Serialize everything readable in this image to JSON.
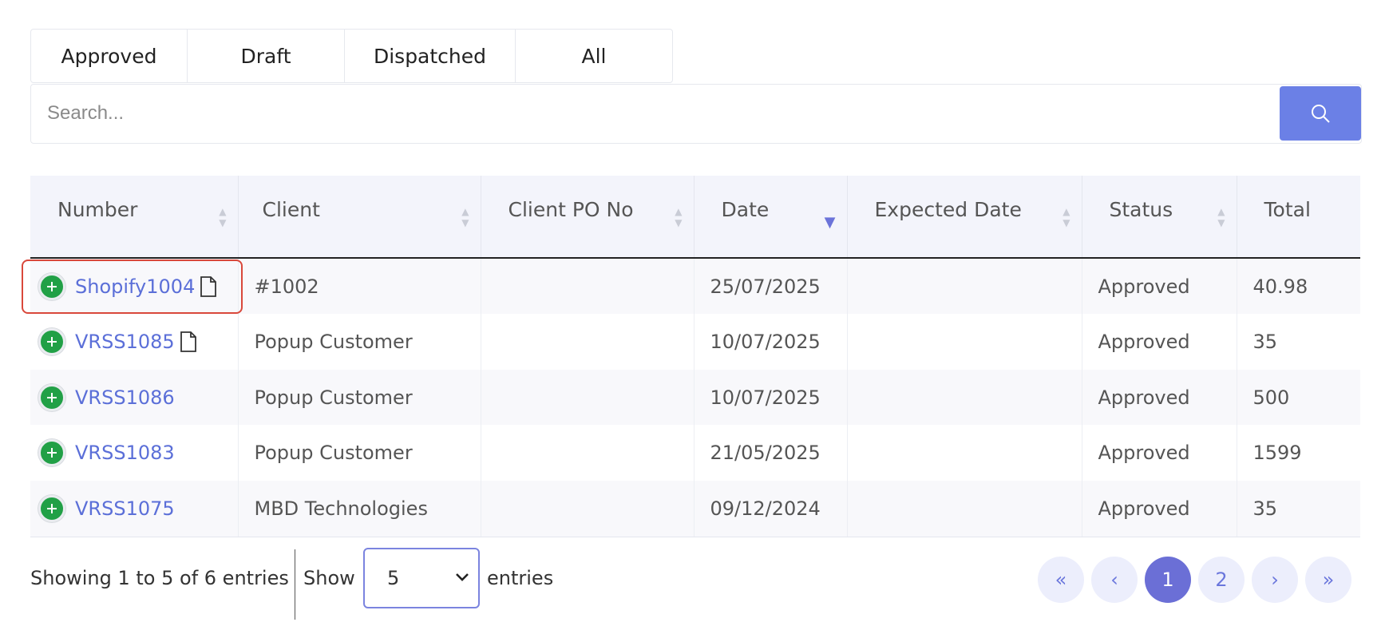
{
  "tabs": [
    "Approved",
    "Draft",
    "Dispatched",
    "All"
  ],
  "search": {
    "placeholder": "Search..."
  },
  "table": {
    "headers": [
      "Number",
      "Client",
      "Client PO No",
      "Date",
      "Expected Date",
      "Status",
      "Total"
    ],
    "rows": [
      {
        "number": "Shopify1004",
        "client": "#1002",
        "po": "",
        "date": "25/07/2025",
        "expected": "",
        "status": "Approved",
        "total": "40.98"
      },
      {
        "number": "VRSS1085",
        "client": "Popup Customer",
        "po": "",
        "date": "10/07/2025",
        "expected": "",
        "status": "Approved",
        "total": "35"
      },
      {
        "number": "VRSS1086",
        "client": "Popup Customer",
        "po": "",
        "date": "10/07/2025",
        "expected": "",
        "status": "Approved",
        "total": "500"
      },
      {
        "number": "VRSS1083",
        "client": "Popup Customer",
        "po": "",
        "date": "21/05/2025",
        "expected": "",
        "status": "Approved",
        "total": "1599"
      },
      {
        "number": "VRSS1075",
        "client": "MBD Technologies",
        "po": "",
        "date": "09/12/2024",
        "expected": "",
        "status": "Approved",
        "total": "35"
      }
    ]
  },
  "footer": {
    "showing": "Showing 1 to 5 of 6 entries",
    "show_label": "Show",
    "page_size": "5",
    "entries_label": "entries"
  },
  "pagination": {
    "first": "«",
    "prev": "‹",
    "pages": [
      "1",
      "2"
    ],
    "next": "›",
    "last": "»",
    "current": "1"
  },
  "colors": {
    "accent": "#6b80e6",
    "link": "#5b6fd8",
    "add_green": "#21a046",
    "highlight": "#d9483b"
  }
}
